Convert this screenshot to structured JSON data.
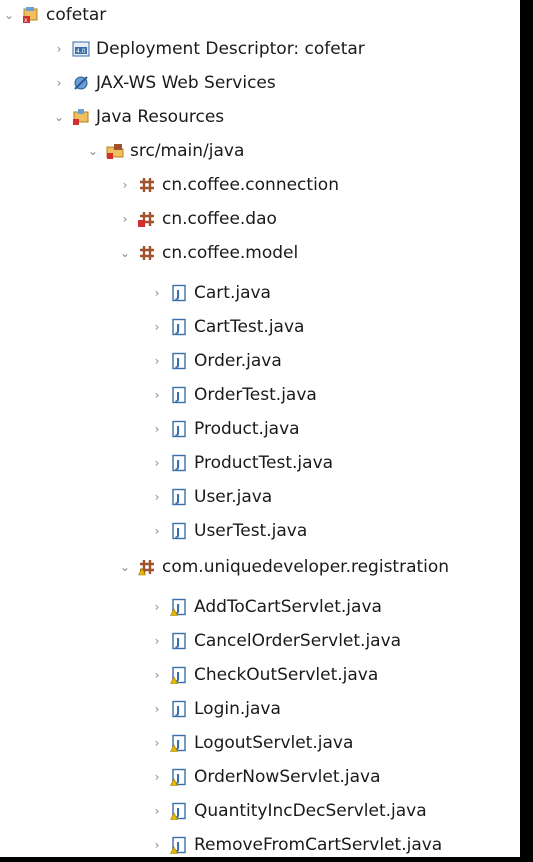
{
  "project": {
    "label": "cofetar",
    "icon": "dynamic-web-project-icon",
    "expanded": true
  },
  "deployment_descriptor": {
    "label": "Deployment Descriptor: cofetar",
    "icon": "deployment-descriptor-icon",
    "expanded": false
  },
  "jaxws": {
    "label": "JAX-WS Web Services",
    "icon": "web-services-icon",
    "expanded": false
  },
  "java_resources": {
    "label": "Java Resources",
    "icon": "java-resources-icon",
    "expanded": true
  },
  "src_folder": {
    "label": "src/main/java",
    "icon": "source-folder-icon",
    "expanded": true
  },
  "packages": [
    {
      "label": "cn.coffee.connection",
      "icon": "package-icon",
      "expanded": false
    },
    {
      "label": "cn.coffee.dao",
      "icon": "package-error-icon",
      "expanded": false
    },
    {
      "label": "cn.coffee.model",
      "icon": "package-icon",
      "expanded": true
    }
  ],
  "model_files": [
    {
      "label": "Cart.java",
      "icon": "java-file-icon"
    },
    {
      "label": "CartTest.java",
      "icon": "java-file-icon"
    },
    {
      "label": "Order.java",
      "icon": "java-file-icon"
    },
    {
      "label": "OrderTest.java",
      "icon": "java-file-icon"
    },
    {
      "label": "Product.java",
      "icon": "java-file-icon"
    },
    {
      "label": "ProductTest.java",
      "icon": "java-file-icon"
    },
    {
      "label": "User.java",
      "icon": "java-file-icon"
    },
    {
      "label": "UserTest.java",
      "icon": "java-file-icon"
    }
  ],
  "registration_package": {
    "label": "com.uniquedeveloper.registration",
    "icon": "package-warning-icon",
    "expanded": true
  },
  "registration_files": [
    {
      "label": "AddToCartServlet.java",
      "icon": "java-file-warning-icon"
    },
    {
      "label": "CancelOrderServlet.java",
      "icon": "java-file-icon"
    },
    {
      "label": "CheckOutServlet.java",
      "icon": "java-file-warning-icon"
    },
    {
      "label": "Login.java",
      "icon": "java-file-icon"
    },
    {
      "label": "LogoutServlet.java",
      "icon": "java-file-warning-icon"
    },
    {
      "label": "OrderNowServlet.java",
      "icon": "java-file-warning-icon"
    },
    {
      "label": "QuantityIncDecServlet.java",
      "icon": "java-file-warning-icon"
    },
    {
      "label": "RemoveFromCartServlet.java",
      "icon": "java-file-warning-icon"
    }
  ],
  "colors": {
    "package_brown": "#a0522d",
    "java_file_blue": "#3b6ea8",
    "error_red": "#d32f2f",
    "warning_yellow": "#e8b800",
    "twisty_gray": "#8a8a8a"
  }
}
